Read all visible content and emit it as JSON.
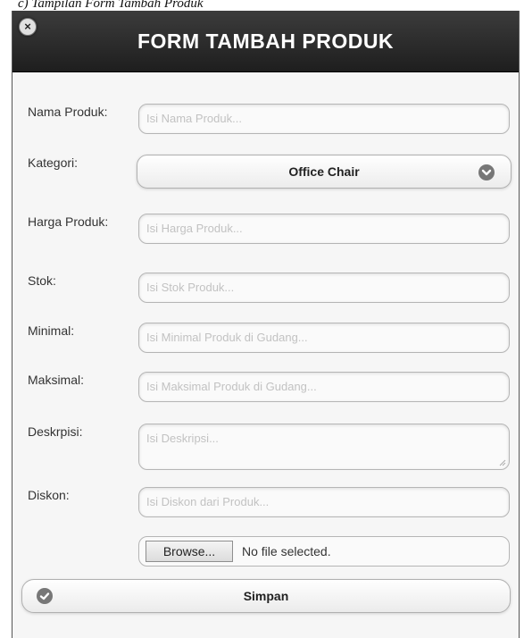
{
  "caption": "c) Tampilan Form Tambah Produk",
  "header": {
    "title": "FORM TAMBAH PRODUK"
  },
  "close_icon": "close-icon",
  "form": {
    "nama": {
      "label": "Nama Produk:",
      "placeholder": "Isi Nama Produk..."
    },
    "kategori": {
      "label": "Kategori:",
      "selected": "Office Chair"
    },
    "harga": {
      "label": "Harga Produk:",
      "placeholder": "Isi Harga Produk..."
    },
    "stok": {
      "label": "Stok:",
      "placeholder": "Isi Stok Produk..."
    },
    "minimal": {
      "label": "Minimal:",
      "placeholder": "Isi Minimal Produk di Gudang..."
    },
    "maksimal": {
      "label": "Maksimal:",
      "placeholder": "Isi Maksimal Produk di Gudang..."
    },
    "deskripsi": {
      "label": "Deskrpisi:",
      "placeholder": "Isi Deskripsi..."
    },
    "diskon": {
      "label": "Diskon:",
      "placeholder": "Isi Diskon dari Produk..."
    },
    "file": {
      "button": "Browse...",
      "status": "No file selected."
    }
  },
  "actions": {
    "save_label": "Simpan"
  },
  "colors": {
    "header_bg": "#2a2a2a",
    "header_text": "#ffffff",
    "placeholder": "#c2c2c2"
  }
}
